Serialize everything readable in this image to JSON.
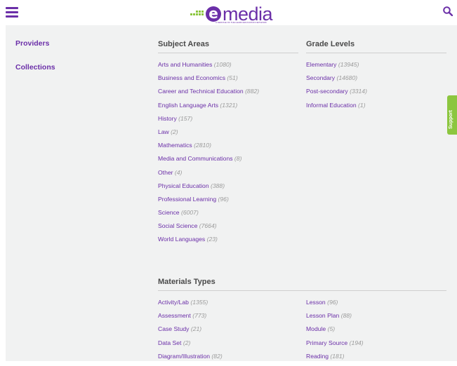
{
  "colors": {
    "brand": "#6b2fa8",
    "accent": "#8cc63f",
    "panel": "#f1f2f2",
    "muted": "#9a9a9a"
  },
  "header": {
    "menu_icon": "hamburger-menu-icon",
    "logo_text": "media",
    "logo_letter": "e",
    "logo_tagline": "A SERVICE OF THE LEARN EDUCATION NETWORK",
    "search_icon": "search-icon"
  },
  "sidebar": {
    "items": [
      {
        "label": "Providers"
      },
      {
        "label": "Collections"
      }
    ]
  },
  "subject_areas": {
    "title": "Subject Areas",
    "items": [
      {
        "label": "Arts and Humanities",
        "count": "(1080)"
      },
      {
        "label": "Business and Economics",
        "count": "(51)"
      },
      {
        "label": "Career and Technical Education",
        "count": "(882)"
      },
      {
        "label": "English Language Arts",
        "count": "(1321)"
      },
      {
        "label": "History",
        "count": "(157)"
      },
      {
        "label": "Law",
        "count": "(2)"
      },
      {
        "label": "Mathematics",
        "count": "(2810)"
      },
      {
        "label": "Media and Communications",
        "count": "(8)"
      },
      {
        "label": "Other",
        "count": "(4)"
      },
      {
        "label": "Physical Education",
        "count": "(388)"
      },
      {
        "label": "Professional Learning",
        "count": "(96)"
      },
      {
        "label": "Science",
        "count": "(6007)"
      },
      {
        "label": "Social Science",
        "count": "(7664)"
      },
      {
        "label": "World Languages",
        "count": "(23)"
      }
    ]
  },
  "grade_levels": {
    "title": "Grade Levels",
    "items": [
      {
        "label": "Elementary",
        "count": "(13945)"
      },
      {
        "label": "Secondary",
        "count": "(14680)"
      },
      {
        "label": "Post-secondary",
        "count": "(3314)"
      },
      {
        "label": "Informal Education",
        "count": "(1)"
      }
    ]
  },
  "materials_types": {
    "title": "Materials Types",
    "left": [
      {
        "label": "Activity/Lab",
        "count": "(1355)"
      },
      {
        "label": "Assessment",
        "count": "(773)"
      },
      {
        "label": "Case Study",
        "count": "(21)"
      },
      {
        "label": "Data Set",
        "count": "(2)"
      },
      {
        "label": "Diagram/Illustration",
        "count": "(82)"
      }
    ],
    "right": [
      {
        "label": "Lesson",
        "count": "(96)"
      },
      {
        "label": "Lesson Plan",
        "count": "(88)"
      },
      {
        "label": "Module",
        "count": "(5)"
      },
      {
        "label": "Primary Source",
        "count": "(194)"
      },
      {
        "label": "Reading",
        "count": "(181)"
      }
    ]
  },
  "support_tab": {
    "label": "Support"
  }
}
